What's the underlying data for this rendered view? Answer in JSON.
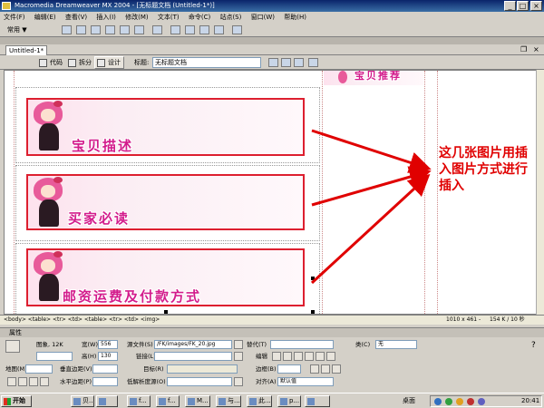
{
  "window": {
    "title": "Macromedia Dreamweaver MX 2004 - [无标题文档 (Untitled-1*)]"
  },
  "menu": [
    "文件(F)",
    "编辑(E)",
    "查看(V)",
    "插入(I)",
    "修改(M)",
    "文本(T)",
    "命令(C)",
    "站点(S)",
    "窗口(W)",
    "帮助(H)"
  ],
  "insert_bar": {
    "category": "常用 ▼"
  },
  "document_tab": {
    "label": "Untitled-1*"
  },
  "doc_toolbar": {
    "code_label": "代码",
    "split_label": "拆分",
    "design_label": "设计",
    "title_label": "标题:",
    "title_value": "无标题文档"
  },
  "banners": [
    {
      "text": "宝贝描述"
    },
    {
      "text": "买家必读"
    },
    {
      "text": "邮资运费及付款方式"
    }
  ],
  "top_banner": {
    "text": "宝贝推荐"
  },
  "annotation": {
    "text": "这几张图片用插入图片方式进行插入"
  },
  "status": {
    "tag_path": "<body> <table> <tr> <td> <table> <tr> <td> <img>",
    "dimensions": "1010 x 461 -",
    "filesize": "154 K / 10 秒"
  },
  "properties": {
    "header": "属性",
    "image_label": "图象, 12K",
    "width_label": "宽(W)",
    "width_value": "556",
    "height_label": "高(H)",
    "height_value": "130",
    "src_label": "源文件(S)",
    "src_value": "/FK/images/FK_20.jpg",
    "alt_label": "替代(T)",
    "class_label": "类(C)",
    "class_value": "无",
    "link_label": "链接(L)",
    "edit_label": "编辑",
    "map_label": "地图(M)",
    "vspace_label": "垂直边距(V)",
    "target_label": "目标(R)",
    "border_label": "边框(B)",
    "hspace_label": "水平边距(P)",
    "lowsrc_label": "低解析度源(O)",
    "align_label": "对齐(A)",
    "align_value": "默认值"
  },
  "taskbar": {
    "start_label": "开始",
    "tasks": [
      "贝...",
      "f...",
      "f...",
      "M...",
      "与...",
      "此...",
      "p..."
    ],
    "desktop_label": "桌面",
    "clock": "20:41"
  }
}
